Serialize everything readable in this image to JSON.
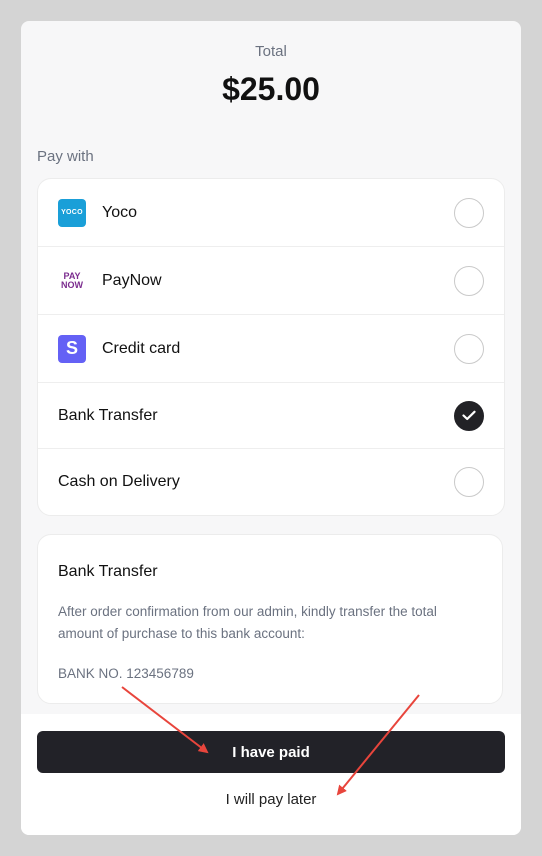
{
  "summary": {
    "total_label": "Total",
    "total_amount": "$25.00"
  },
  "payment": {
    "pay_with_label": "Pay with",
    "methods": [
      {
        "label": "Yoco",
        "icon": "yoco-logo-icon",
        "icon_text": "YOCO",
        "selected": false
      },
      {
        "label": "PayNow",
        "icon": "paynow-logo-icon",
        "icon_text_top": "PAY",
        "icon_text_bottom": "NOW",
        "selected": false
      },
      {
        "label": "Credit card",
        "icon": "stripe-logo-icon",
        "icon_text": "S",
        "selected": false
      },
      {
        "label": "Bank Transfer",
        "selected": true
      },
      {
        "label": "Cash on Delivery",
        "selected": false
      }
    ]
  },
  "details": {
    "title": "Bank Transfer",
    "text": "After order confirmation from our admin, kindly transfer the total amount of purchase to this bank account:",
    "bank_no": "BANK NO. 123456789"
  },
  "actions": {
    "paid_label": "I have paid",
    "later_label": "I will pay later"
  },
  "colors": {
    "accent_dark": "#222228",
    "arrow": "#e8453c",
    "yoco": "#1a9fd8",
    "paynow": "#7b2c8e",
    "stripe": "#6461f5"
  }
}
